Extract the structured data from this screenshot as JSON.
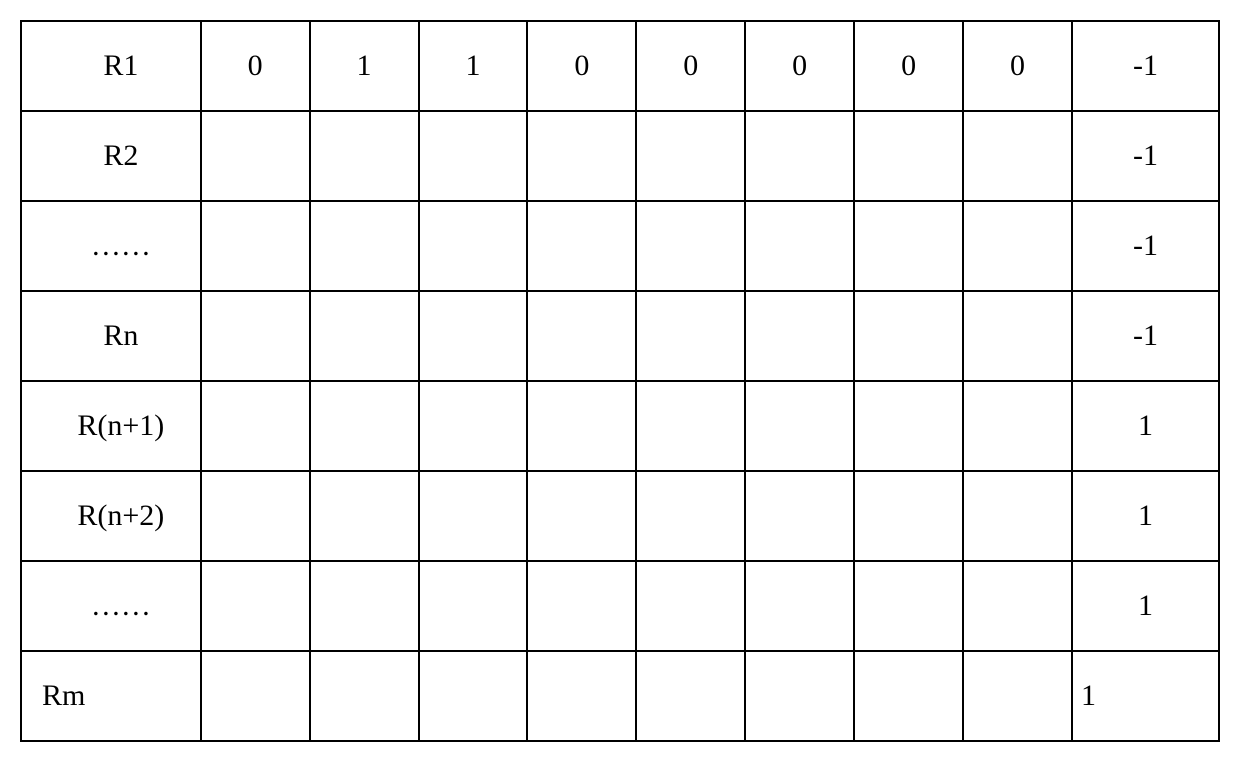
{
  "table": {
    "rows": [
      {
        "label": "R1",
        "cells": [
          "0",
          "1",
          "1",
          "0",
          "0",
          "0",
          "0",
          "0"
        ],
        "last": "-1",
        "lastLeftAlign": false
      },
      {
        "label": "R2",
        "cells": [
          "",
          "",
          "",
          "",
          "",
          "",
          "",
          ""
        ],
        "last": "-1",
        "lastLeftAlign": false
      },
      {
        "label": "……",
        "cells": [
          "",
          "",
          "",
          "",
          "",
          "",
          "",
          ""
        ],
        "last": "-1",
        "lastLeftAlign": false
      },
      {
        "label": "Rn",
        "cells": [
          "",
          "",
          "",
          "",
          "",
          "",
          "",
          ""
        ],
        "last": "-1",
        "lastLeftAlign": false
      },
      {
        "label": "R(n+1)",
        "cells": [
          "",
          "",
          "",
          "",
          "",
          "",
          "",
          ""
        ],
        "last": "1",
        "lastLeftAlign": false
      },
      {
        "label": "R(n+2)",
        "cells": [
          "",
          "",
          "",
          "",
          "",
          "",
          "",
          ""
        ],
        "last": "1",
        "lastLeftAlign": false
      },
      {
        "label": "……",
        "cells": [
          "",
          "",
          "",
          "",
          "",
          "",
          "",
          ""
        ],
        "last": "1",
        "lastLeftAlign": false
      },
      {
        "label": "Rm",
        "cells": [
          "",
          "",
          "",
          "",
          "",
          "",
          "",
          ""
        ],
        "last": "1",
        "lastLeftAlign": true,
        "labelLeftAlign": true
      }
    ]
  }
}
